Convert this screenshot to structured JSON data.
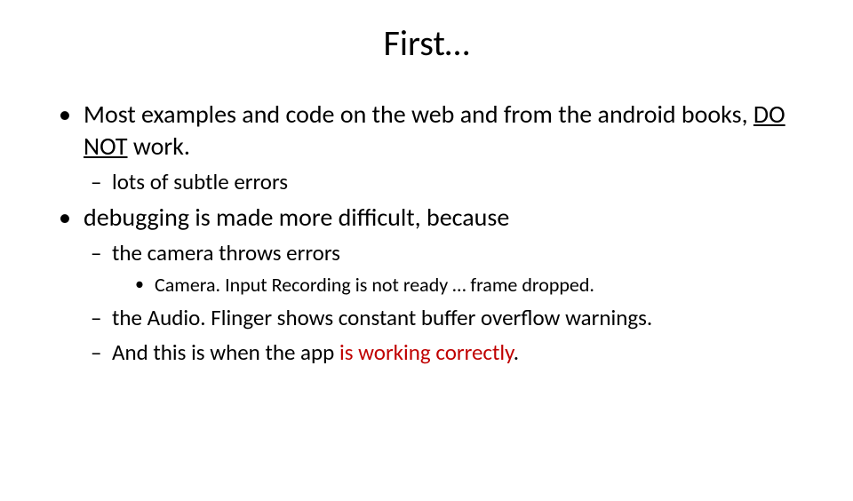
{
  "title": "First…",
  "bullets": {
    "b1a": "Most examples and code on the web and from the android books, ",
    "b1_do_not": "DO NOT",
    "b1b": " work.",
    "b1_1": "lots of subtle errors",
    "b2": "debugging is made more difficult, because",
    "b2_1": "the camera throws errors",
    "b2_1_1": "Camera. Input  Recording is not ready … frame dropped.",
    "b2_2": "the Audio. Flinger shows constant buffer overflow warnings.",
    "b2_3a": "And this is when the app ",
    "b2_3b_red": "is working correctly",
    "b2_3c": "."
  }
}
